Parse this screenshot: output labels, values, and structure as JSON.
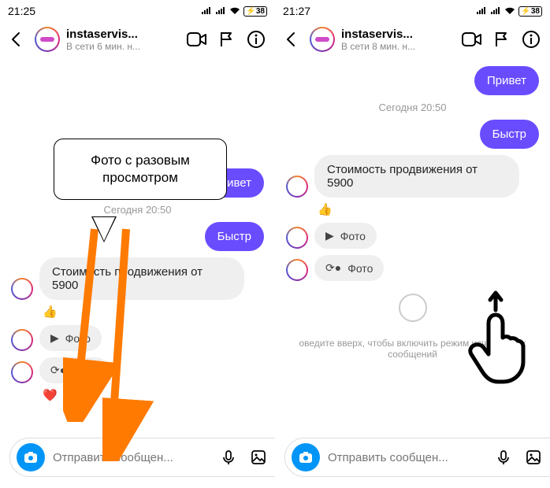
{
  "left": {
    "status_time": "21:25",
    "battery": "38",
    "header": {
      "name": "instaservis...",
      "presence": "В сети 6 мин. н..."
    },
    "callout": "Фото с разовым просмотром",
    "msg_hello": "Привет",
    "date_sep": "Сегодня 20:50",
    "msg_fast": "Быстр",
    "msg_price": "Стоимость продвижения от 5900",
    "reaction1": "👍",
    "photo1": "Фото",
    "photo2": "Фото",
    "reaction2": "❤️",
    "composer_placeholder": "Отправить сообщен..."
  },
  "right": {
    "status_time": "21:27",
    "battery": "38",
    "header": {
      "name": "instaservis...",
      "presence": "В сети 8 мин. н..."
    },
    "msg_hello": "Привет",
    "date_sep": "Сегодня 20:50",
    "msg_fast": "Быстр",
    "msg_price": "Стоимость продвижения от 5900",
    "reaction1": "👍",
    "photo1": "Фото",
    "photo2": "Фото",
    "vanish_hint": "оведите вверх, чтобы включить режим исчезающих сообщений",
    "composer_placeholder": "Отправить сообщен..."
  }
}
